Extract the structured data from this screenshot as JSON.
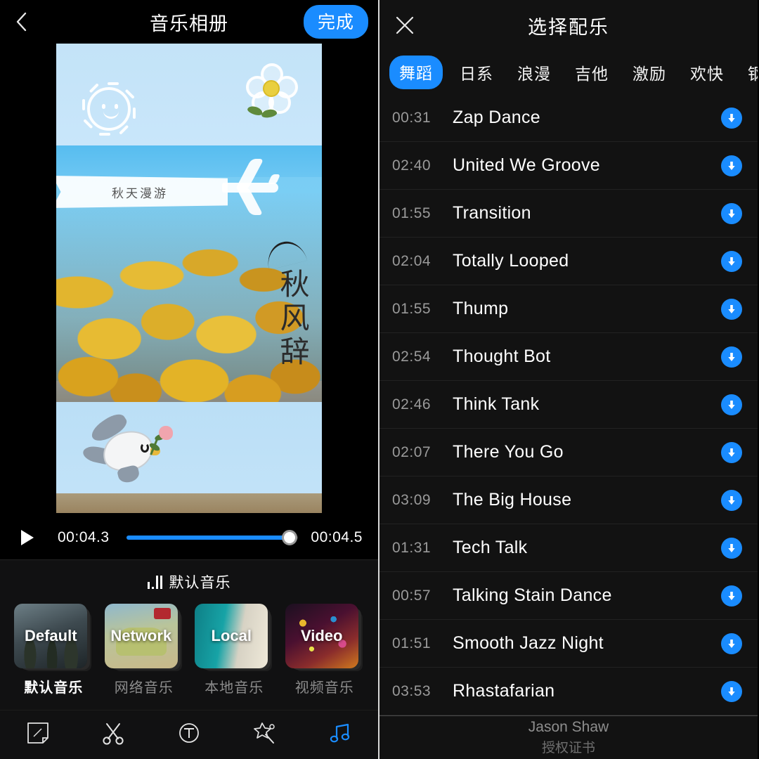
{
  "left": {
    "header": {
      "back_icon": "chevron-left-icon",
      "title": "音乐相册",
      "done_label": "完成"
    },
    "preview": {
      "banner_text": "秋天漫游",
      "vertical_text": "秋风辞",
      "stickers": [
        "sun-doodle-sticker",
        "flower-sticker",
        "airplane-sticker",
        "dove-with-rose-sticker"
      ]
    },
    "playback": {
      "play_icon": "play-icon",
      "current_time": "00:04.3",
      "total_time": "00:04.5",
      "progress_percent": 95
    },
    "music": {
      "eq_icon": "equalizer-icon",
      "current_label": "默认音乐",
      "sources": [
        {
          "cover_text": "Default",
          "label": "默认音乐",
          "selected": true
        },
        {
          "cover_text": "Network",
          "label": "网络音乐",
          "selected": false
        },
        {
          "cover_text": "Local",
          "label": "本地音乐",
          "selected": false
        },
        {
          "cover_text": "Video",
          "label": "视频音乐",
          "selected": false
        }
      ]
    },
    "toolbar": [
      {
        "icon": "sticker-icon",
        "active": false
      },
      {
        "icon": "scissors-icon",
        "active": false
      },
      {
        "icon": "text-icon",
        "active": false
      },
      {
        "icon": "magic-wand-icon",
        "active": false
      },
      {
        "icon": "music-note-icon",
        "active": true
      }
    ]
  },
  "right": {
    "header": {
      "close_icon": "close-icon",
      "title": "选择配乐"
    },
    "tabs": [
      {
        "label": "舞蹈",
        "active": true
      },
      {
        "label": "日系",
        "active": false
      },
      {
        "label": "浪漫",
        "active": false
      },
      {
        "label": "吉他",
        "active": false
      },
      {
        "label": "激励",
        "active": false
      },
      {
        "label": "欢快",
        "active": false
      },
      {
        "label": "钢琴",
        "active": false
      }
    ],
    "tracks": [
      {
        "duration": "00:31",
        "name": "Zap Dance"
      },
      {
        "duration": "02:40",
        "name": "United We Groove"
      },
      {
        "duration": "01:55",
        "name": "Transition"
      },
      {
        "duration": "02:04",
        "name": "Totally Looped"
      },
      {
        "duration": "01:55",
        "name": "Thump"
      },
      {
        "duration": "02:54",
        "name": "Thought Bot"
      },
      {
        "duration": "02:46",
        "name": "Think Tank"
      },
      {
        "duration": "02:07",
        "name": "There You Go"
      },
      {
        "duration": "03:09",
        "name": "The Big House"
      },
      {
        "duration": "01:31",
        "name": "Tech Talk"
      },
      {
        "duration": "00:57",
        "name": "Talking Stain Dance"
      },
      {
        "duration": "01:51",
        "name": "Smooth Jazz Night"
      },
      {
        "duration": "03:53",
        "name": "Rhastafarian"
      }
    ],
    "download_icon": "download-icon",
    "footer": {
      "artist": "Jason Shaw",
      "license": "授权证书"
    }
  },
  "colors": {
    "accent": "#1a8cff",
    "background": "#000000",
    "panel": "#121212",
    "text": "#ffffff",
    "muted": "#9a9a9a"
  }
}
